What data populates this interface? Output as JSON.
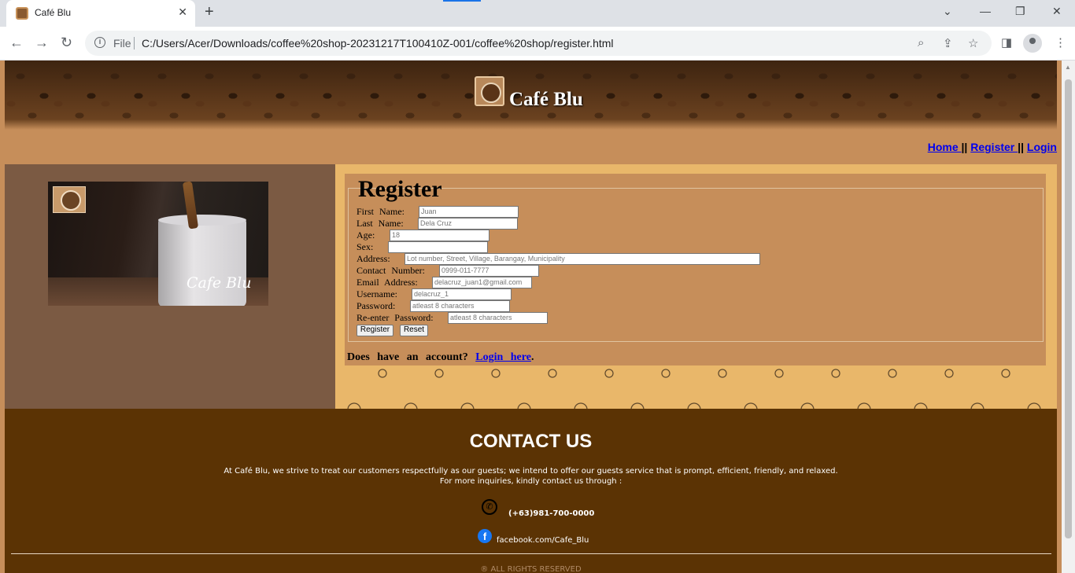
{
  "browser": {
    "tab_title": "Café Blu",
    "new_tab_symbol": "+",
    "close_symbol": "✕",
    "url_scheme_label": "File",
    "url": "C:/Users/Acer/Downloads/coffee%20shop-20231217T100410Z-001/coffee%20shop/register.html",
    "icons": [
      "back-icon",
      "forward-icon",
      "reload-icon",
      "info-icon",
      "zoom-icon",
      "share-icon",
      "star-icon",
      "sidebar-icon",
      "profile-icon",
      "menu-icon",
      "minimize-icon",
      "maximize-icon",
      "close-icon",
      "tab-list-icon"
    ]
  },
  "header": {
    "brand": "Café Blu"
  },
  "nav": {
    "home": "Home ",
    "sep1": "|| ",
    "register": "Register ",
    "sep2": "|| ",
    "login": "Login"
  },
  "left_image": {
    "caption": "Cafe Blu"
  },
  "register_form": {
    "title": "Register",
    "fields": [
      {
        "label": "First Name:",
        "value": "Juan"
      },
      {
        "label": "Last Name:",
        "value": "Dela Cruz"
      },
      {
        "label": "Age:",
        "value": "18"
      },
      {
        "label": "Sex:",
        "value": ""
      },
      {
        "label": "Address:",
        "value": "Lot number, Street, Village, Barangay, Municipality"
      },
      {
        "label": "Contact Number:",
        "value": "0999-011-7777"
      },
      {
        "label": "Email Address:",
        "value": "delacruz_juan1@gmail.com"
      },
      {
        "label": "Username:",
        "value": "delacruz_1"
      },
      {
        "label": "Password:",
        "value": "atleast 8 characters"
      },
      {
        "label": "Re-enter Password:",
        "value": "atleast 8 characters"
      }
    ],
    "register_button": "Register",
    "reset_button": "Reset",
    "account_prompt": "Does have an account? ",
    "login_link": "Login here",
    "period": "."
  },
  "footer": {
    "title": "CONTACT US",
    "line1": "At Café Blu, we strive to treat our customers respectfully as our guests; we intend to offer our guests service that is prompt, efficient, friendly, and relaxed.",
    "line2": "For more inquiries, kindly contact us through :",
    "phone": "(+63)981-700-0000",
    "facebook": "facebook.com/Cafe_Blu",
    "fb_glyph": "f",
    "rights": "® ALL RIGHTS RESERVED"
  },
  "colors": {
    "page_bg": "#c68e5a",
    "left_panel": "#7b5a43",
    "right_panel": "#e9b76a",
    "footer_bg": "#5b3304",
    "link": "#0000ee"
  }
}
